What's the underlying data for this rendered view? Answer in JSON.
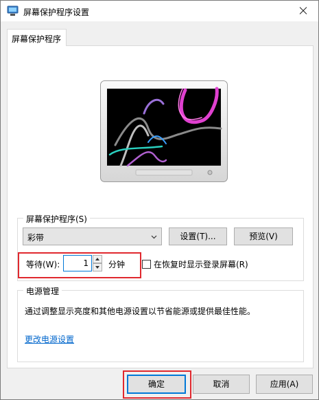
{
  "window": {
    "title": "屏幕保护程序设置"
  },
  "tabs": [
    {
      "label": "屏幕保护程序",
      "active": true
    }
  ],
  "screensaver": {
    "group_title": "屏幕保护程序(S)",
    "selected": "彩带",
    "settings_label": "设置(T)...",
    "preview_label": "预览(V)",
    "wait_label": "等待(W):",
    "wait_value": "1",
    "minutes_label": "分钟",
    "resume_checkbox_label": "在恢复时显示登录屏幕(R)",
    "resume_checked": false
  },
  "power": {
    "group_title": "电源管理",
    "description": "通过调整显示亮度和其他电源设置以节省能源或提供最佳性能。",
    "link": "更改电源设置"
  },
  "buttons": {
    "ok": "确定",
    "cancel": "取消",
    "apply": "应用(A)"
  },
  "colors": {
    "accent": "#0078d7",
    "link": "#0066cc",
    "highlight_frame": "#e0282e"
  }
}
